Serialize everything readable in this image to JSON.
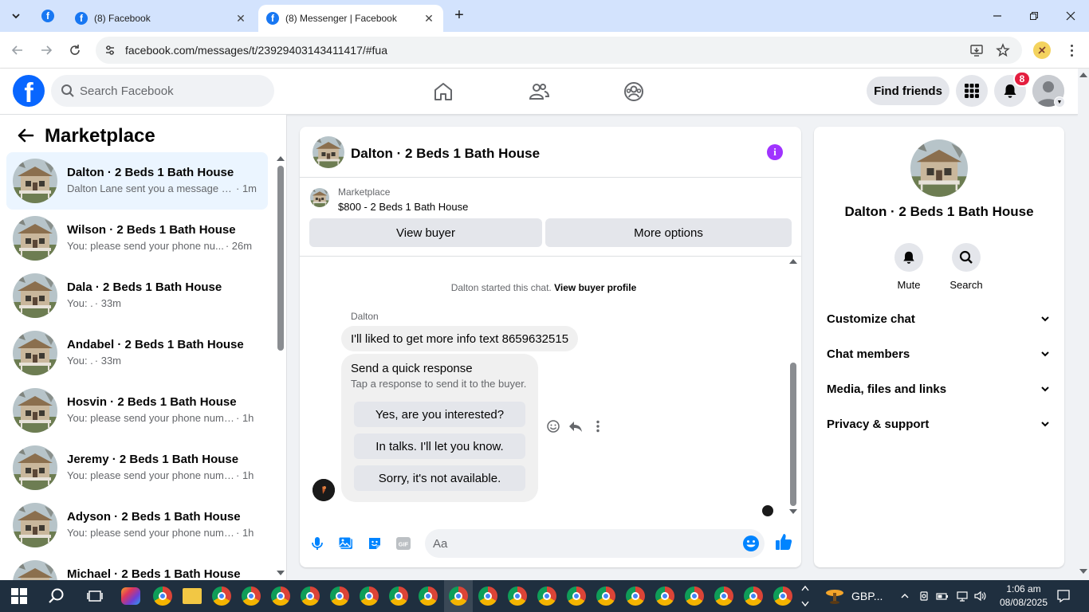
{
  "browser": {
    "tabs": [
      {
        "title": "(8) Facebook"
      },
      {
        "title": "(8) Messenger | Facebook"
      }
    ],
    "url": "facebook.com/messages/t/23929403143411417/#fua"
  },
  "fb_header": {
    "search_placeholder": "Search Facebook",
    "find_friends": "Find friends",
    "notification_count": "8"
  },
  "left": {
    "title": "Marketplace",
    "conversations": [
      {
        "name": "Dalton · 2 Beds 1 Bath House",
        "snippet": "Dalton Lane sent you a message a...",
        "time": "· 1m"
      },
      {
        "name": "Wilson · 2 Beds 1 Bath House",
        "snippet": "You: please send your phone nu...",
        "time": "· 26m"
      },
      {
        "name": "Dala · 2 Beds 1 Bath House",
        "snippet": "You: .",
        "time": "· 33m"
      },
      {
        "name": "Andabel · 2 Beds 1 Bath House",
        "snippet": "You: .",
        "time": "· 33m"
      },
      {
        "name": "Hosvin · 2 Beds 1 Bath House",
        "snippet": "You: please send your phone numb...",
        "time": "· 1h"
      },
      {
        "name": "Jeremy · 2 Beds 1 Bath House",
        "snippet": "You: please send your phone numb...",
        "time": "· 1h"
      },
      {
        "name": "Adyson · 2 Beds 1 Bath House",
        "snippet": "You: please send your phone numb...",
        "time": "· 1h"
      },
      {
        "name": "Michael · 2 Beds 1 Bath House",
        "snippet": "",
        "time": ""
      }
    ]
  },
  "chat": {
    "title": "Dalton · 2 Beds 1 Bath House",
    "marketplace_label": "Marketplace",
    "listing": "$800 - 2 Beds 1 Bath House",
    "view_buyer": "View buyer",
    "more_options": "More options",
    "system_text": "Dalton started this chat.",
    "system_link": "View buyer profile",
    "sender": "Dalton",
    "message": "I'll liked to get more info text 8659632515",
    "quick_title": "Send a quick response",
    "quick_subtitle": "Tap a response to send it to the buyer.",
    "quick_responses": [
      "Yes, are you interested?",
      "In talks. I'll let you know.",
      "Sorry, it's not available."
    ],
    "input_placeholder": "Aa"
  },
  "right": {
    "name": "Dalton · 2 Beds 1 Bath House",
    "mute": "Mute",
    "search": "Search",
    "sections": [
      "Customize chat",
      "Chat members",
      "Media, files and links",
      "Privacy & support"
    ]
  },
  "taskbar": {
    "currency": "GBP...",
    "time": "1:06 am",
    "date": "08/08/2025"
  },
  "colors": {
    "facebook_blue": "#0866ff",
    "messenger_blue": "#0084ff",
    "info_purple": "#a033ff",
    "badge_red": "#e41e3f",
    "selected_row": "#ebf5ff"
  }
}
